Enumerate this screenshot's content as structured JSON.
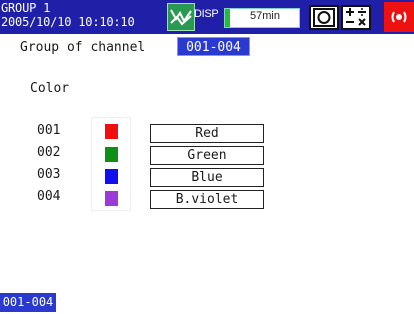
{
  "titlebar": {
    "group_name": "GROUP 1",
    "datetime": "2005/10/10 10:10:10",
    "disp_label": "DISP",
    "memory_remaining": "57min",
    "colors": {
      "bar": "#1f1fa8",
      "trend_icon": "#2a9a52",
      "memory_fill": "#1fbf3a",
      "alarm": "#ee1111"
    },
    "icons": [
      "trend-display-icon",
      "memory-status-icon",
      "record-icon",
      "math-icon",
      "alarm-icon"
    ]
  },
  "main": {
    "group_label": "Group of channel",
    "group_value": "001-004",
    "section_label": "Color",
    "channels": [
      {
        "number": "001",
        "color": "Red",
        "swatch": "#ee1010"
      },
      {
        "number": "002",
        "color": "Green",
        "swatch": "#108f18"
      },
      {
        "number": "003",
        "color": "Blue",
        "swatch": "#1010ee"
      },
      {
        "number": "004",
        "color": "B.violet",
        "swatch": "#9b3ad6"
      }
    ]
  },
  "footer": {
    "selected_group": "001-004"
  }
}
